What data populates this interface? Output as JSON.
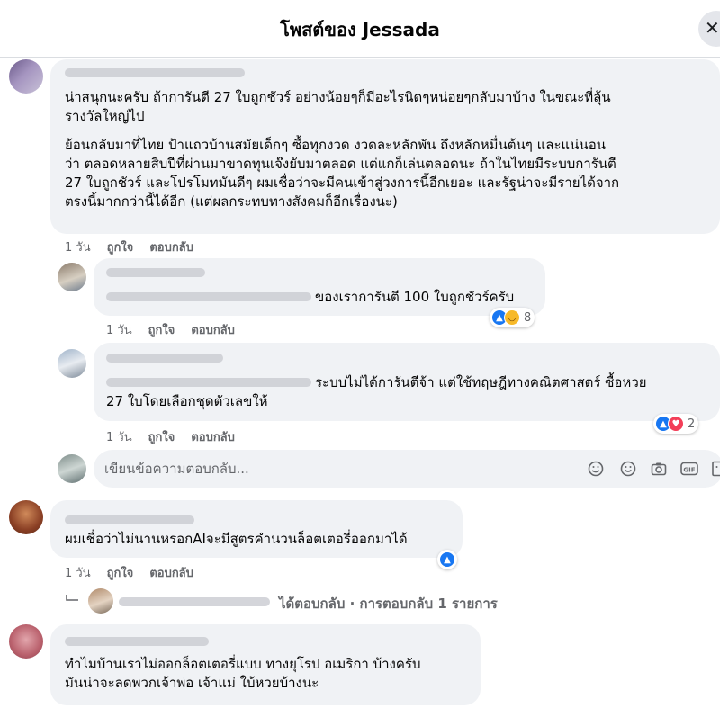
{
  "header": {
    "title": "โพสต์ของ Jessada",
    "close_label": "✕"
  },
  "colors": {
    "accent": "#1877f2",
    "bubble": "#f0f2f5",
    "muted": "#65676b"
  },
  "comments": [
    {
      "paragraphs": [
        "น่าสนุกนะครับ ถ้าการันตี 27 ใบถูกชัวร์ อย่างน้อยๆก็มีอะไรนิดๆหน่อยๆกลับมาบ้าง ในขณะที่ลุ้น",
        "รางวัลใหญ่ไป",
        "ย้อนกลับมาที่ไทย ป้าแถวบ้านสมัยเด็กๆ ซื้อทุกงวด งวดละหลักพัน ถึงหลักหมื่นต้นๆ และแน่นอน",
        "ว่า ตลอดหลายสิบปีที่ผ่านมาขาดทุนเจ๊งยับมาตลอด แต่แกก็เล่นตลอดนะ ถ้าในไทยมีระบบการันตี",
        "27 ใบถูกชัวร์ และโปรโมทมันดีๆ ผมเชื่อว่าจะมีคนเข้าสู่วงการนี้อีกเยอะ และรัฐน่าจะมีรายได้จาก",
        "ตรงนี้มากกว่านี้ได้อีก (แต่ผลกระทบทางสังคมก็อีกเรื่องนะ)"
      ],
      "time": "1 วัน",
      "like": "ถูกใจ",
      "reply": "ตอบกลับ"
    },
    {
      "text": "ของเราการันตี 100 ใบถูกชัวร์ครับ",
      "time": "1 วัน",
      "like": "ถูกใจ",
      "reply": "ตอบกลับ",
      "reaction_count": "8"
    },
    {
      "line1": "ระบบไม่ได้การันตีจ้า แต่ใช้ทฤษฎีทางคณิตศาสตร์ ซื้อหวย",
      "line2": "27 ใบโดยเลือกชุดตัวเลขให้",
      "time": "1 วัน",
      "like": "ถูกใจ",
      "reply": "ตอบกลับ",
      "reaction_count": "2"
    },
    {
      "text": "ผมเชื่อว่าไม่นานหรอกAIจะมีสูตรคำนวนล็อตเตอรี่ออกมาได้",
      "time": "1 วัน",
      "like": "ถูกใจ",
      "reply": "ตอบกลับ"
    },
    {
      "line1": "ทำไมบ้านเราไม่ออกล็อตเตอรี่แบบ ทางยุโรป อเมริกา บ้างครับ",
      "line2": "มันน่าจะลดพวกเจ้าพ่อ เจ้าแม่ ใบ้หวยบ้างนะ"
    }
  ],
  "reply_box": {
    "placeholder": "เขียนข้อความตอบกลับ..."
  },
  "thread_summary": "ได้ตอบกลับ · การตอบกลับ 1 รายการ",
  "icons": [
    "sticker-icon",
    "emoji-icon",
    "camera-icon",
    "gif-icon",
    "sticker2-icon"
  ]
}
